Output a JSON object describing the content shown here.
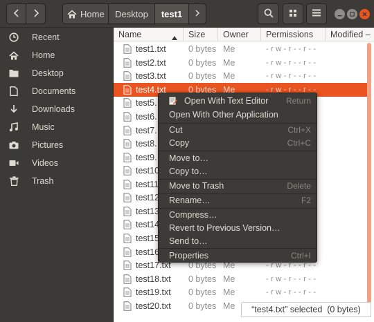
{
  "header": {
    "back_label": "‹",
    "forward_label": "›",
    "breadcrumb": [
      "Home",
      "Desktop",
      "test1"
    ]
  },
  "sidebar": {
    "items": [
      {
        "label": "Recent",
        "icon": "clock-icon"
      },
      {
        "label": "Home",
        "icon": "home-icon"
      },
      {
        "label": "Desktop",
        "icon": "folder-icon"
      },
      {
        "label": "Documents",
        "icon": "document-icon"
      },
      {
        "label": "Downloads",
        "icon": "download-icon"
      },
      {
        "label": "Music",
        "icon": "music-icon"
      },
      {
        "label": "Pictures",
        "icon": "camera-icon"
      },
      {
        "label": "Videos",
        "icon": "video-icon"
      },
      {
        "label": "Trash",
        "icon": "trash-icon"
      }
    ]
  },
  "columns": [
    "Name",
    "Size",
    "Owner",
    "Permissions",
    "Modified –"
  ],
  "files": [
    {
      "name": "test1.txt",
      "size": "0 bytes",
      "owner": "Me",
      "perms": "- r w - r - - r - -"
    },
    {
      "name": "test2.txt",
      "size": "0 bytes",
      "owner": "Me",
      "perms": "- r w - r - - r - -"
    },
    {
      "name": "test3.txt",
      "size": "0 bytes",
      "owner": "Me",
      "perms": "- r w - r - - r - -"
    },
    {
      "name": "test4.txt",
      "size": "0 bytes",
      "owner": "Me",
      "perms": "- r w - r - - r - -"
    },
    {
      "name": "test5.",
      "size": "",
      "owner": "",
      "perms": ""
    },
    {
      "name": "test6.",
      "size": "",
      "owner": "",
      "perms": ""
    },
    {
      "name": "test7.",
      "size": "",
      "owner": "",
      "perms": ""
    },
    {
      "name": "test8.",
      "size": "",
      "owner": "",
      "perms": ""
    },
    {
      "name": "test9.",
      "size": "",
      "owner": "",
      "perms": ""
    },
    {
      "name": "test10",
      "size": "",
      "owner": "",
      "perms": ""
    },
    {
      "name": "test11",
      "size": "",
      "owner": "",
      "perms": ""
    },
    {
      "name": "test12",
      "size": "",
      "owner": "",
      "perms": ""
    },
    {
      "name": "test13",
      "size": "",
      "owner": "",
      "perms": ""
    },
    {
      "name": "test14",
      "size": "",
      "owner": "",
      "perms": ""
    },
    {
      "name": "test15",
      "size": "",
      "owner": "",
      "perms": ""
    },
    {
      "name": "test16",
      "size": "",
      "owner": "",
      "perms": ""
    },
    {
      "name": "test17.txt",
      "size": "0 bytes",
      "owner": "Me",
      "perms": "- r w - r - - r - -"
    },
    {
      "name": "test18.txt",
      "size": "0 bytes",
      "owner": "Me",
      "perms": "- r w - r - - r - -"
    },
    {
      "name": "test19.txt",
      "size": "0 bytes",
      "owner": "Me",
      "perms": "- r w - r - - r - -"
    },
    {
      "name": "test20.txt",
      "size": "0 bytes",
      "owner": "Me",
      "perms": ""
    }
  ],
  "selected_index": 3,
  "context_menu": {
    "items": [
      {
        "label": "Open With Text Editor",
        "accel": "Return",
        "icon": "text-editor-icon"
      },
      {
        "label": "Open With Other Application",
        "accel": ""
      },
      {
        "label": "Cut",
        "accel": "Ctrl+X"
      },
      {
        "label": "Copy",
        "accel": "Ctrl+C"
      },
      {
        "label": "Move to…",
        "accel": ""
      },
      {
        "label": "Copy to…",
        "accel": ""
      },
      {
        "label": "Move to Trash",
        "accel": "Delete"
      },
      {
        "label": "Rename…",
        "accel": "F2"
      },
      {
        "label": "Compress…",
        "accel": ""
      },
      {
        "label": "Revert to Previous Version…",
        "accel": ""
      },
      {
        "label": "Send to…",
        "accel": ""
      },
      {
        "label": "Properties",
        "accel": "Ctrl+I"
      }
    ]
  },
  "status": "“test4.txt” selected  (0 bytes)",
  "colors": {
    "accent": "#e95420",
    "chrome": "#3c3b37",
    "text_light": "#dfdbd2"
  }
}
